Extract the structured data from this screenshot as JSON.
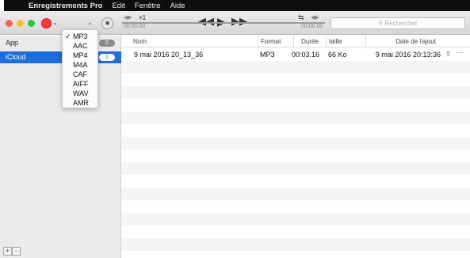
{
  "menubar": {
    "apple_icon": "apple-icon",
    "items": [
      "Enregistrements Pro",
      "Edit",
      "Fenêtre",
      "Aide"
    ]
  },
  "toolbar": {
    "rec_color": "#f23a3a",
    "speed_label": "×1",
    "time_start": "00:00.00",
    "time_end": "00:00.00",
    "search_placeholder": "Rechercher",
    "search_icon": "search-icon"
  },
  "sidebar": {
    "items": [
      {
        "label": "App",
        "count": "0",
        "selected": false
      },
      {
        "label": "iCloud",
        "count": "1",
        "selected": true
      }
    ],
    "add_label": "+",
    "remove_label": "−"
  },
  "format_menu": {
    "selected": "MP3",
    "options": [
      "MP3",
      "AAC",
      "MP4",
      "M4A",
      "CAF",
      "AIFF",
      "WAV",
      "AMR"
    ]
  },
  "table": {
    "columns": [
      "Nom",
      "Format",
      "Durée",
      "taille",
      "Date de l'ajout"
    ],
    "rows": [
      {
        "name": "9 mai 2016 20_13_36",
        "format": "MP3",
        "duration": "00:03.16",
        "size": "66 Ko",
        "date": "9 mai 2016 20:13:36"
      }
    ],
    "row_actions": [
      "share-icon",
      "more-icon"
    ],
    "more_label": "···"
  },
  "colors": {
    "accent": "#1e6ddc",
    "close": "#fc5f57",
    "minimize": "#fdbc2e",
    "zoom": "#28c840"
  }
}
